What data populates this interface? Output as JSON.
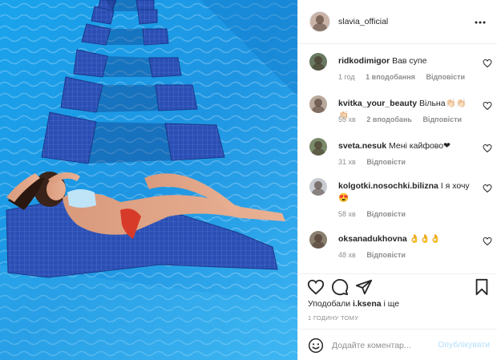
{
  "post": {
    "author": "slavia_official",
    "photo_icon": "pool-photo-icon"
  },
  "comments": [
    {
      "username": "ridkodimigor",
      "text": "Вав супе",
      "time": "1 год",
      "likes": "1 вподобання",
      "reply": "Відповісти"
    },
    {
      "username": "kvitka_your_beauty",
      "text": "Вільна👏🏻👏🏻👏🏻",
      "time": "55 хв",
      "likes": "2 вподобань",
      "reply": "Відповісти"
    },
    {
      "username": "sveta.nesuk",
      "text": "Мені кайфово❤",
      "time": "31 хв",
      "reply": "Відповісти"
    },
    {
      "username": "kolgotki.nosochki.bilizna",
      "text": "І я хочу 😍",
      "time": "58 хв",
      "reply": "Відповісти"
    },
    {
      "username": "oksanadukhovna",
      "text": "👌👌👌",
      "time": "48 хв",
      "reply": "Відповісти"
    }
  ],
  "actions": {
    "liked_by_prefix": "Уподобали",
    "liked_by_user": "i.ksena",
    "liked_by_suffix": "і ще",
    "posted_time": "1 ГОДИНУ ТОМУ"
  },
  "add_comment": {
    "placeholder": "Додайте коментар...",
    "publish_label": "Опублікувати"
  },
  "colors": {
    "water": "#1e9be6",
    "tile_blue": "#2c4fb0",
    "link_blue": "#b2dffc",
    "muted": "#8e8e8e"
  }
}
